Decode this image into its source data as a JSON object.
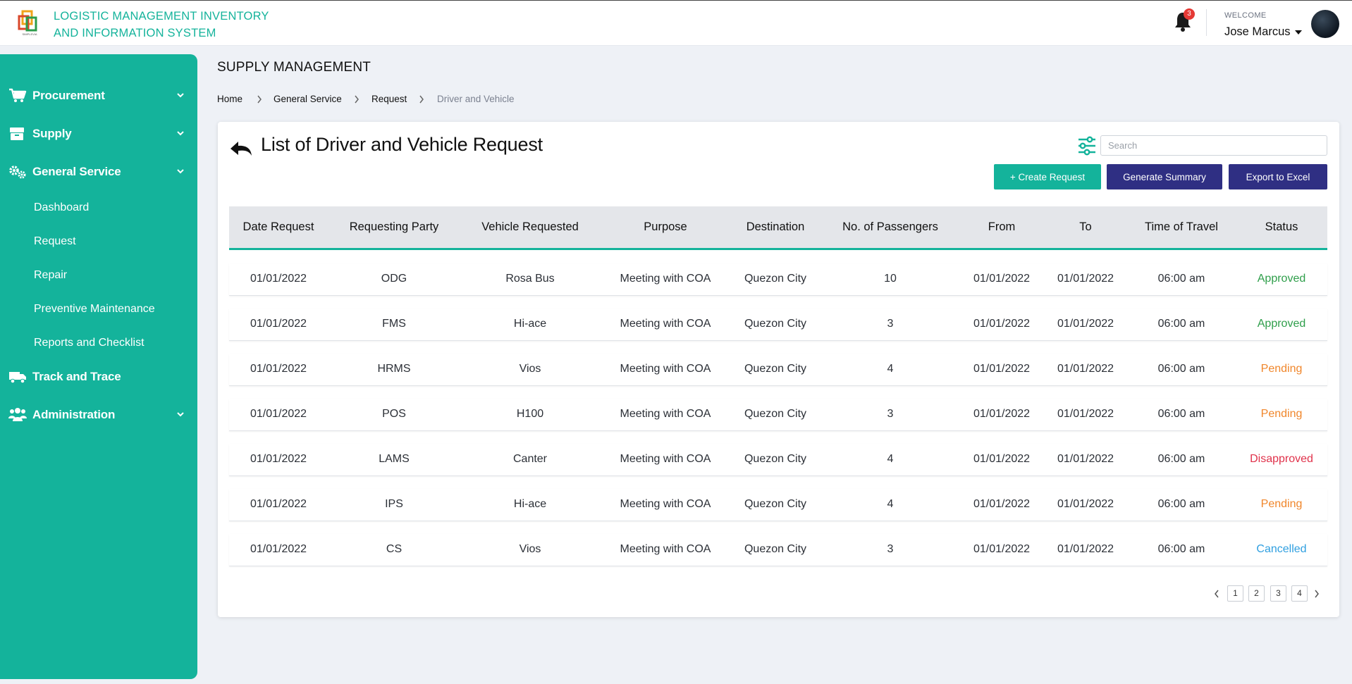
{
  "header": {
    "brand_line1": "LOGISTIC MANAGEMENT INVENTORY",
    "brand_line2": "AND INFORMATION SYSTEM",
    "notification_count": "3",
    "welcome": "WELCOME",
    "user_name": "Jose Marcus",
    "logo_icon": "simplevia-logo",
    "bell_icon": "bell-icon",
    "brand_color": "#14b39b"
  },
  "sidebar": {
    "items": [
      {
        "label": "Procurement",
        "icon": "cart-icon"
      },
      {
        "label": "Supply",
        "icon": "box-icon"
      },
      {
        "label": "General Service",
        "icon": "gears-icon"
      },
      {
        "label": "Track and Trace",
        "icon": "truck-icon"
      },
      {
        "label": "Administration",
        "icon": "users-icon"
      }
    ],
    "sub_items": [
      "Dashboard",
      "Request",
      "Repair",
      "Preventive Maintenance",
      "Reports and Checklist"
    ]
  },
  "main": {
    "page_title": "SUPPLY MANAGEMENT",
    "breadcrumb": [
      "Home",
      "General Service",
      "Request",
      "Driver and Vehicle"
    ],
    "card_title": "List of Driver and Vehicle Request",
    "search_placeholder": "Search",
    "buttons": {
      "create": "+ Create Request",
      "summary": "Generate Summary",
      "export": "Export to Excel"
    }
  },
  "table": {
    "columns": [
      "Date Request",
      "Requesting Party",
      "Vehicle Requested",
      "Purpose",
      "Destination",
      "No. of Passengers",
      "From",
      "To",
      "Time of Travel",
      "Status"
    ],
    "rows": [
      [
        "01/01/2022",
        "ODG",
        "Rosa Bus",
        "Meeting with COA",
        "Quezon City",
        "10",
        "01/01/2022",
        "01/01/2022",
        "06:00 am",
        "Approved"
      ],
      [
        "01/01/2022",
        "FMS",
        "Hi-ace",
        "Meeting with COA",
        "Quezon City",
        "3",
        "01/01/2022",
        "01/01/2022",
        "06:00 am",
        "Approved"
      ],
      [
        "01/01/2022",
        "HRMS",
        "Vios",
        "Meeting with COA",
        "Quezon City",
        "4",
        "01/01/2022",
        "01/01/2022",
        "06:00 am",
        "Pending"
      ],
      [
        "01/01/2022",
        "POS",
        "H100",
        "Meeting with COA",
        "Quezon City",
        "3",
        "01/01/2022",
        "01/01/2022",
        "06:00 am",
        "Pending"
      ],
      [
        "01/01/2022",
        "LAMS",
        "Canter",
        "Meeting with COA",
        "Quezon City",
        "4",
        "01/01/2022",
        "01/01/2022",
        "06:00 am",
        "Disapproved"
      ],
      [
        "01/01/2022",
        "IPS",
        "Hi-ace",
        "Meeting with COA",
        "Quezon City",
        "4",
        "01/01/2022",
        "01/01/2022",
        "06:00 am",
        "Pending"
      ],
      [
        "01/01/2022",
        "CS",
        "Vios",
        "Meeting with COA",
        "Quezon City",
        "3",
        "01/01/2022",
        "01/01/2022",
        "06:00 am",
        "Cancelled"
      ]
    ],
    "status_colors": {
      "Approved": "#2e9e4a",
      "Pending": "#f0862b",
      "Disapproved": "#e0324b",
      "Cancelled": "#2f9fe0"
    }
  },
  "pagination": {
    "pages": [
      "1",
      "2",
      "3",
      "4"
    ]
  }
}
